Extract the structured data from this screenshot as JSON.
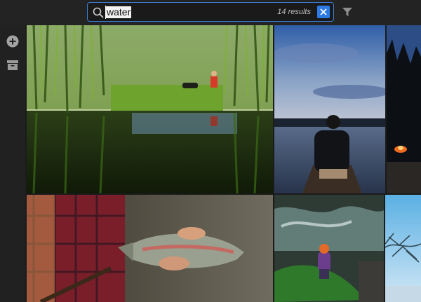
{
  "search": {
    "query": "water",
    "results_label": "14 results",
    "icon": "search-icon"
  },
  "toolbar": {
    "clear_icon": "close-icon",
    "filter_icon": "filter-icon"
  },
  "rail": {
    "items": [
      {
        "icon": "add-icon"
      },
      {
        "icon": "archive-icon"
      }
    ]
  },
  "colors": {
    "accent": "#2c7ae4",
    "background": "#1b1b1b",
    "topbar": "#232323"
  }
}
